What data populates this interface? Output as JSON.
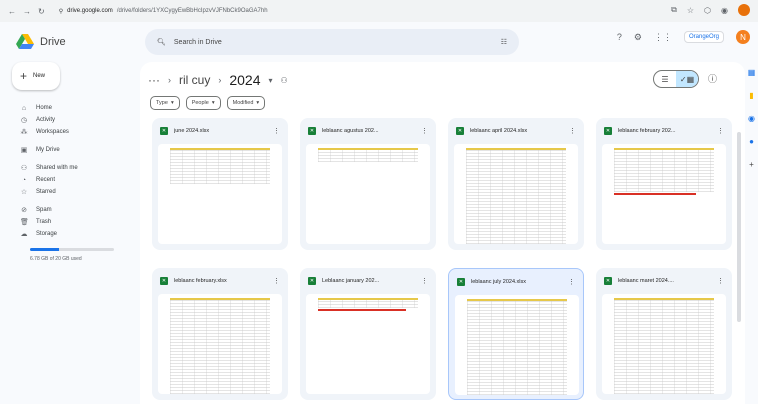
{
  "browser": {
    "url_domain": "drive.google.com",
    "url_path": "/drive/folders/1YXCygyEwBbHcIpzvVJFNbCk9OaGA7hh"
  },
  "app": {
    "title": "Drive"
  },
  "search": {
    "placeholder": "Search in Drive"
  },
  "topbar": {
    "org_label": "OrangeOrg"
  },
  "avatar_letter": "N",
  "new_button": "New",
  "sidebar": {
    "items": [
      {
        "label": "Home",
        "icon": "home-icon",
        "glyph": "⌂"
      },
      {
        "label": "Activity",
        "icon": "activity-icon",
        "glyph": "◷"
      },
      {
        "label": "Workspaces",
        "icon": "workspaces-icon",
        "glyph": "⁂"
      },
      {
        "label": "My Drive",
        "icon": "my-drive-icon",
        "glyph": "▣"
      },
      {
        "label": "Shared with me",
        "icon": "shared-icon",
        "glyph": "⚇"
      },
      {
        "label": "Recent",
        "icon": "recent-icon",
        "glyph": "◔"
      },
      {
        "label": "Starred",
        "icon": "star-icon",
        "glyph": "☆"
      },
      {
        "label": "Spam",
        "icon": "spam-icon",
        "glyph": "⊘"
      },
      {
        "label": "Trash",
        "icon": "trash-icon",
        "glyph": "🗑"
      },
      {
        "label": "Storage",
        "icon": "storage-icon",
        "glyph": "☁"
      }
    ],
    "storage_text": "6.78 GB of 20 GB used",
    "storage_fraction": 0.34
  },
  "breadcrumb": {
    "ellipsis": "···",
    "parent": "ril cuy",
    "current": "2024"
  },
  "filters": [
    "Type",
    "People",
    "Modified"
  ],
  "files": [
    {
      "name": "june 2024.xlsx",
      "red_bar": false,
      "selected": false
    },
    {
      "name": "leblaanc agustus 202...",
      "red_bar": false,
      "selected": false
    },
    {
      "name": "leblaanc april 2024.xlsx",
      "red_bar": false,
      "selected": false
    },
    {
      "name": "leblaanc february 202...",
      "red_bar": true,
      "selected": false
    },
    {
      "name": "leblaanc february.xlsx",
      "red_bar": false,
      "selected": false
    },
    {
      "name": "Leblaanc january 202...",
      "red_bar": true,
      "selected": false
    },
    {
      "name": "leblaanc july 2024.xlsx",
      "red_bar": false,
      "selected": true
    },
    {
      "name": "leblaanc maret 2024....",
      "red_bar": false,
      "selected": false
    }
  ]
}
